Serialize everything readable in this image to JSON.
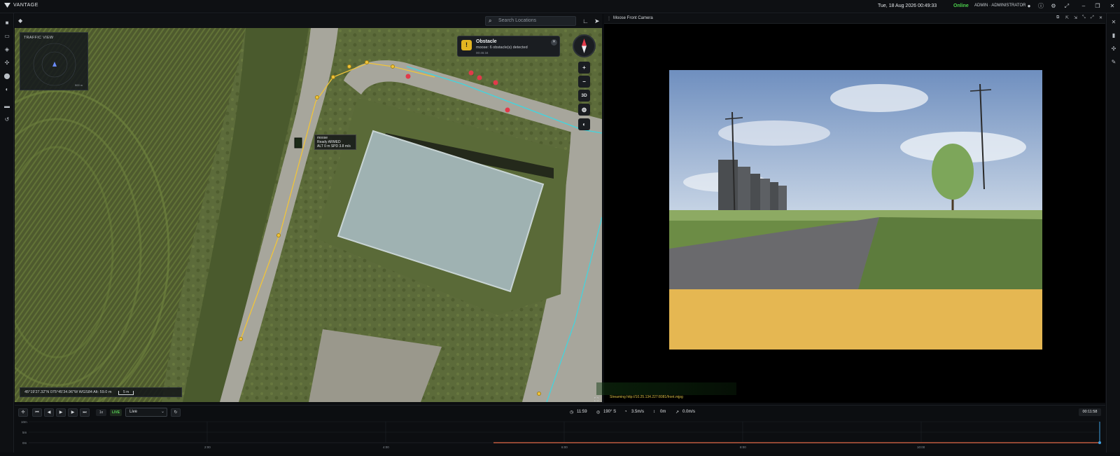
{
  "app": {
    "brand": "VANTAGE"
  },
  "topbar": {
    "datetime": "Tue, 18 Aug 2026 00:49:33",
    "status": "Online",
    "user": "ADMIN · ADMINISTRATOR"
  },
  "map": {
    "search_placeholder": "Search Locations",
    "traffic_view_title": "TRAFFIC VIEW",
    "traffic_scale": "500 m",
    "uav_tooltip": {
      "name": "moose",
      "state": "Ready ARMED",
      "telemetry": "ALT 0 m  SPD 3.8 m/s"
    },
    "coordinates": "45°19'27.32\"N 075°45'34.96\"W WGS84 Alt: 59.0 m",
    "scale_label": "5 m",
    "controls": {
      "zoom_in": "+",
      "zoom_out": "−",
      "toggle_3d": "3D"
    }
  },
  "notification": {
    "title": "Obstacle",
    "message": "moose: 6 obstacle(s) detected",
    "time": "00:46:34"
  },
  "camera": {
    "title": "Moose Front Camera",
    "stream": "Streaming http://10.25.134.227:8081/front.mjpg"
  },
  "timeline": {
    "speed": "1x",
    "live": "LIVE",
    "mode": "Live",
    "stats": {
      "time": "11:59",
      "heading": "190° S",
      "speed": "3.5m/s",
      "altitude": "0m",
      "vspeed": "0.0m/s"
    },
    "elapsed": "00:11:58",
    "y_ticks": [
      "10m",
      "5m",
      "0m"
    ],
    "x_ticks": [
      "2:00",
      "4:00",
      "6:00",
      "8:00",
      "10:00"
    ]
  },
  "colors": {
    "accent_online": "#4cd24c",
    "route_yellow": "#f0c43a",
    "route_cyan": "#3fd6e0",
    "obstacle_red": "#e23a4a",
    "warning": "#e3b521"
  }
}
